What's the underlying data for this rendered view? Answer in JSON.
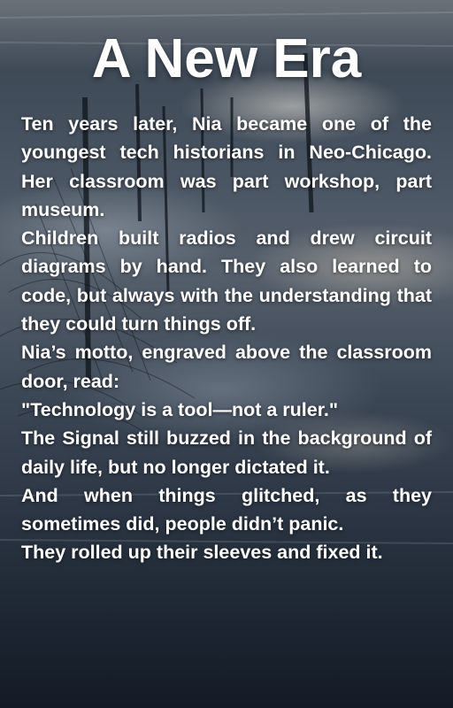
{
  "title": "A New Era",
  "paragraphs": [
    "Ten years later, Nia became one of the youngest tech historians in Neo-Chicago. Her classroom was part workshop, part museum.",
    "Children built radios and drew circuit diagrams by hand. They also learned to code, but always with the understanding that they could turn things off.",
    "Nia’s motto, engraved above the classroom door, read:",
    "\"Technology is a tool—not a ruler.\"",
    "The Signal still buzzed in the background of daily life, but no longer dictated it.",
    "And when things glitched, as they sometimes did, people didn’t panic.",
    "They rolled up their sleeves and fixed it."
  ]
}
